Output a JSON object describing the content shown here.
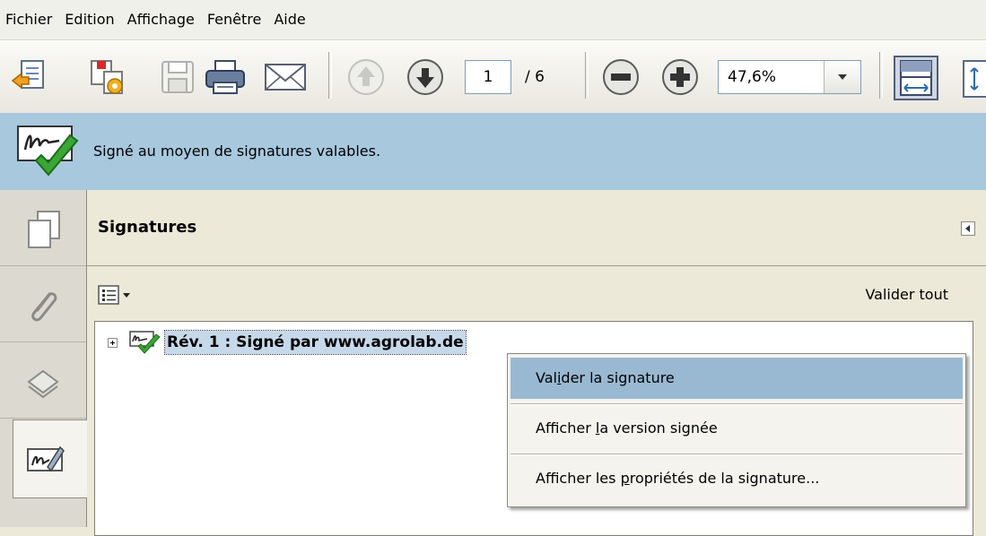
{
  "menubar": {
    "items": [
      "Fichier",
      "Edition",
      "Affichage",
      "Fenêtre",
      "Aide"
    ]
  },
  "toolbar": {
    "icons": [
      "create-pdf-icon",
      "convert-icon",
      "save-icon",
      "print-icon",
      "email-icon",
      "previous-page-icon",
      "next-page-icon",
      "zoom-out-icon",
      "zoom-in-icon",
      "fit-width-icon",
      "fit-page-icon"
    ],
    "current_page": "1",
    "total_pages": "/ 6",
    "zoom": "47,6%"
  },
  "signature_bar": {
    "message": "Signé au moyen de signatures valables."
  },
  "left_nav": {
    "buttons": [
      "pages-icon",
      "attachments-icon",
      "layers-icon",
      "signatures-icon"
    ],
    "active": "signatures-icon"
  },
  "signatures_panel": {
    "title": "Signatures",
    "validate_all": "Valider tout",
    "tree": {
      "entry_label": "Rév. 1 : Signé par www.agrolab.de"
    }
  },
  "context_menu": {
    "items": [
      {
        "pre": "Val",
        "key": "i",
        "post": "der la signature",
        "highlighted": true
      },
      {
        "pre": "Afficher ",
        "key": "l",
        "post": "a version signée",
        "highlighted": false
      },
      {
        "pre": "Afficher les ",
        "key": "p",
        "post": "ropriétés de la signature...",
        "highlighted": false
      }
    ]
  },
  "colors": {
    "signature_bar_bg": "#a8c8de",
    "menu_highlight": "#99b9d2",
    "check_green": "#3aa635"
  }
}
